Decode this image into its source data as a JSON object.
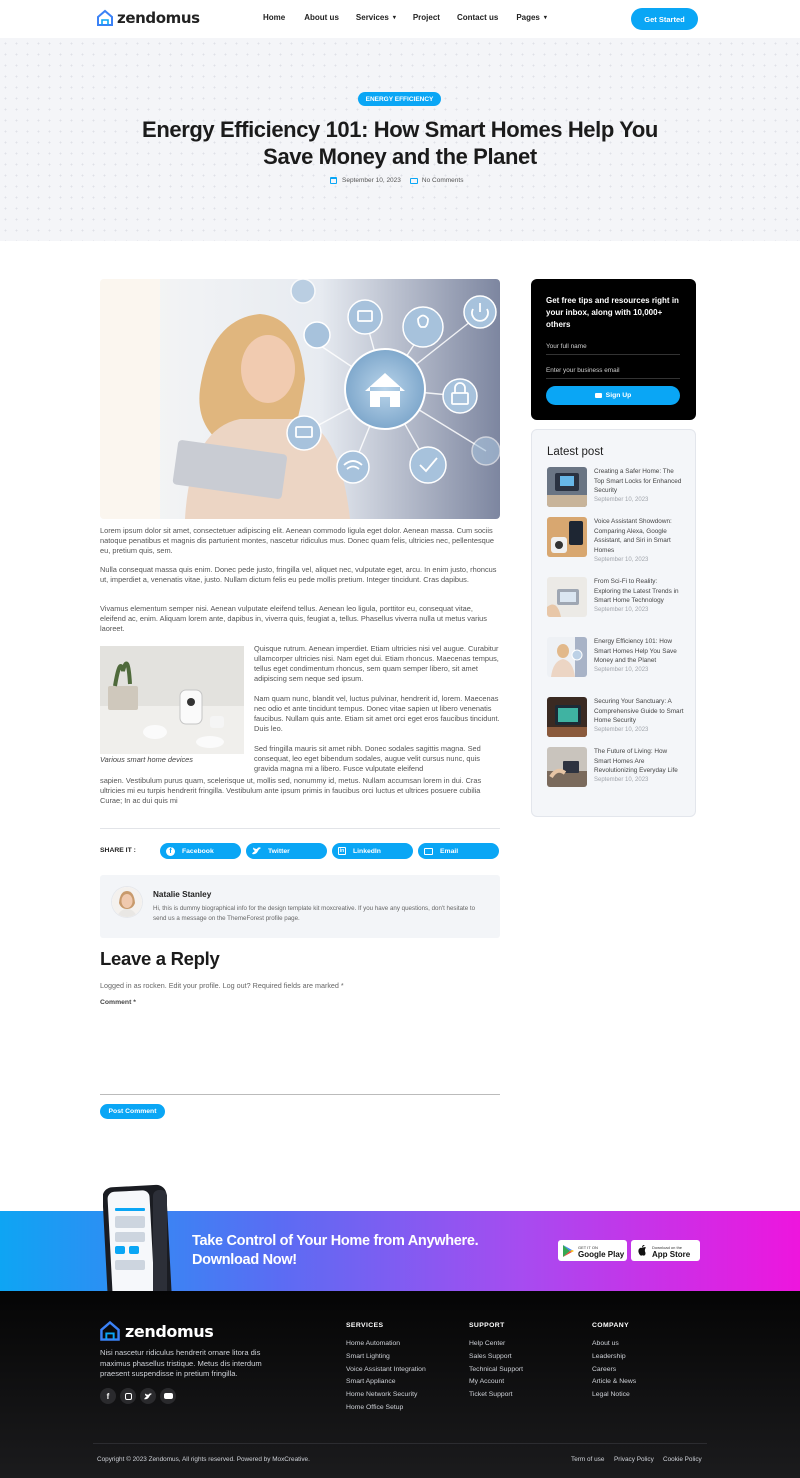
{
  "header": {
    "logo_text": "zendomus",
    "nav": [
      {
        "label": "Home"
      },
      {
        "label": "About us"
      },
      {
        "label": "Services",
        "dropdown": true
      },
      {
        "label": "Project"
      },
      {
        "label": "Contact us"
      },
      {
        "label": "Pages",
        "dropdown": true
      }
    ],
    "cta_label": "Get Started"
  },
  "hero": {
    "category": "ENERGY EFFICIENCY",
    "title_line1": "Energy Efficiency 101: How Smart Homes Help You",
    "title_line2": "Save Money and the Planet",
    "date": "September 10, 2023",
    "comments": "No Comments"
  },
  "article": {
    "p1": "Lorem ipsum dolor sit amet, consectetuer adipiscing elit. Aenean commodo ligula eget dolor. Aenean massa. Cum sociis natoque penatibus et magnis dis parturient montes, nascetur ridiculus mus. Donec quam felis, ultricies nec, pellentesque eu, pretium quis, sem.",
    "p2": "Nulla consequat massa quis enim. Donec pede justo, fringilla vel, aliquet nec, vulputate eget, arcu. In enim justo, rhoncus ut, imperdiet a, venenatis vitae, justo. Nullam dictum felis eu pede mollis pretium. Integer tincidunt. Cras dapibus.",
    "p3": "Vivamus elementum semper nisi. Aenean vulputate eleifend tellus. Aenean leo ligula, porttitor eu, consequat vitae, eleifend ac, enim. Aliquam lorem ante, dapibus in, viverra quis, feugiat a, tellus. Phasellus viverra nulla ut metus varius laoreet.",
    "p4": "Quisque rutrum. Aenean imperdiet. Etiam ultricies nisi vel augue. Curabitur ullamcorper ultricies nisi. Nam eget dui. Etiam rhoncus. Maecenas tempus, tellus eget condimentum rhoncus, sem quam semper libero, sit amet adipiscing sem neque sed ipsum.",
    "p5": "Nam quam nunc, blandit vel, luctus pulvinar, hendrerit id, lorem. Maecenas nec odio et ante tincidunt tempus. Donec vitae sapien ut libero venenatis faucibus. Nullam quis ante. Etiam sit amet orci eget eros faucibus tincidunt. Duis leo.",
    "p6a": "Sed fringilla mauris sit amet nibh. Donec sodales sagittis magna. Sed consequat, leo eget bibendum sodales, augue velit cursus nunc, quis gravida magna mi a libero. Fusce vulputate eleifend",
    "p6b": "sapien. Vestibulum purus quam, scelerisque ut, mollis sed, nonummy id, metus. Nullam accumsan lorem in dui. Cras ultricies mi eu turpis hendrerit fringilla. Vestibulum ante ipsum primis in faucibus orci luctus et ultrices posuere cubilia Curae; In ac dui quis mi",
    "caption": "Various smart home devices"
  },
  "share": {
    "label": "SHARE IT :",
    "buttons": [
      {
        "label": "Facebook",
        "icon": "facebook-icon"
      },
      {
        "label": "Twitter",
        "icon": "twitter-icon"
      },
      {
        "label": "LinkedIn",
        "icon": "linkedin-icon"
      },
      {
        "label": "Email",
        "icon": "email-icon"
      }
    ]
  },
  "author": {
    "name": "Natalie Stanley",
    "bio": "Hi, this is dummy biographical info for the design template kit moxcreative. If you have any questions, don't hesitate to send us a message on the ThemeForest profile page."
  },
  "reply": {
    "title": "Leave a Reply",
    "logged_in": "Logged in as rocken. Edit your profile. Log out? Required fields are marked *",
    "comment_label": "Comment *",
    "comment_value": "",
    "submit_label": "Post Comment"
  },
  "newsletter": {
    "heading": "Get free tips and resources right in your inbox, along with 10,000+ others",
    "name_placeholder": "Your full name",
    "email_placeholder": "Enter your business email",
    "button_label": "Sign Up"
  },
  "latest": {
    "title": "Latest post",
    "posts": [
      {
        "title": "Creating a Safer Home: The Top Smart Locks for Enhanced Security",
        "date": "September 10, 2023"
      },
      {
        "title": "Voice Assistant Showdown: Comparing Alexa, Google Assistant, and Siri in Smart Homes",
        "date": "September 10, 2023"
      },
      {
        "title": "From Sci-Fi to Reality: Exploring the Latest Trends in Smart Home Technology",
        "date": "September 10, 2023"
      },
      {
        "title": "Energy Efficiency 101: How Smart Homes Help You Save Money and the Planet",
        "date": "September 10, 2023"
      },
      {
        "title": "Securing Your Sanctuary: A Comprehensive Guide to Smart Home Security",
        "date": "September 10, 2023"
      },
      {
        "title": "The Future of Living: How Smart Homes Are Revolutionizing Everyday Life",
        "date": "September 10, 2023"
      }
    ]
  },
  "banner": {
    "line1": "Take Control of Your Home from Anywhere.",
    "line2": "Download Now!",
    "google_small": "GET IT ON",
    "google_big": "Google Play",
    "apple_small": "Download on the",
    "apple_big": "App Store"
  },
  "footer": {
    "logo_text": "zendomus",
    "description": "Nisi nascetur ridiculus hendrerit ornare litora dis maximus phasellus tristique. Metus dis interdum praesent suspendisse in pretium fringilla.",
    "columns": [
      {
        "title": "SERVICES",
        "links": [
          "Home Automation",
          "Smart Lighting",
          "Voice Assistant Integration",
          "Smart Appliance",
          "Home Network Security",
          "Home Office Setup"
        ]
      },
      {
        "title": "SUPPORT",
        "links": [
          "Help Center",
          "Sales Support",
          "Technical Support",
          "My Account",
          "Ticket Support"
        ]
      },
      {
        "title": "COMPANY",
        "links": [
          "About us",
          "Leadership",
          "Careers",
          "Article & News",
          "Legal Notice"
        ]
      }
    ],
    "copyright": "Copyright © 2023 Zendomus, All rights reserved. Powered by MoxCreative.",
    "legal": [
      "Term of use",
      "Privacy Policy",
      "Cookie Policy"
    ]
  },
  "colors": {
    "accent": "#0aa6f5",
    "dark": "#000000"
  }
}
